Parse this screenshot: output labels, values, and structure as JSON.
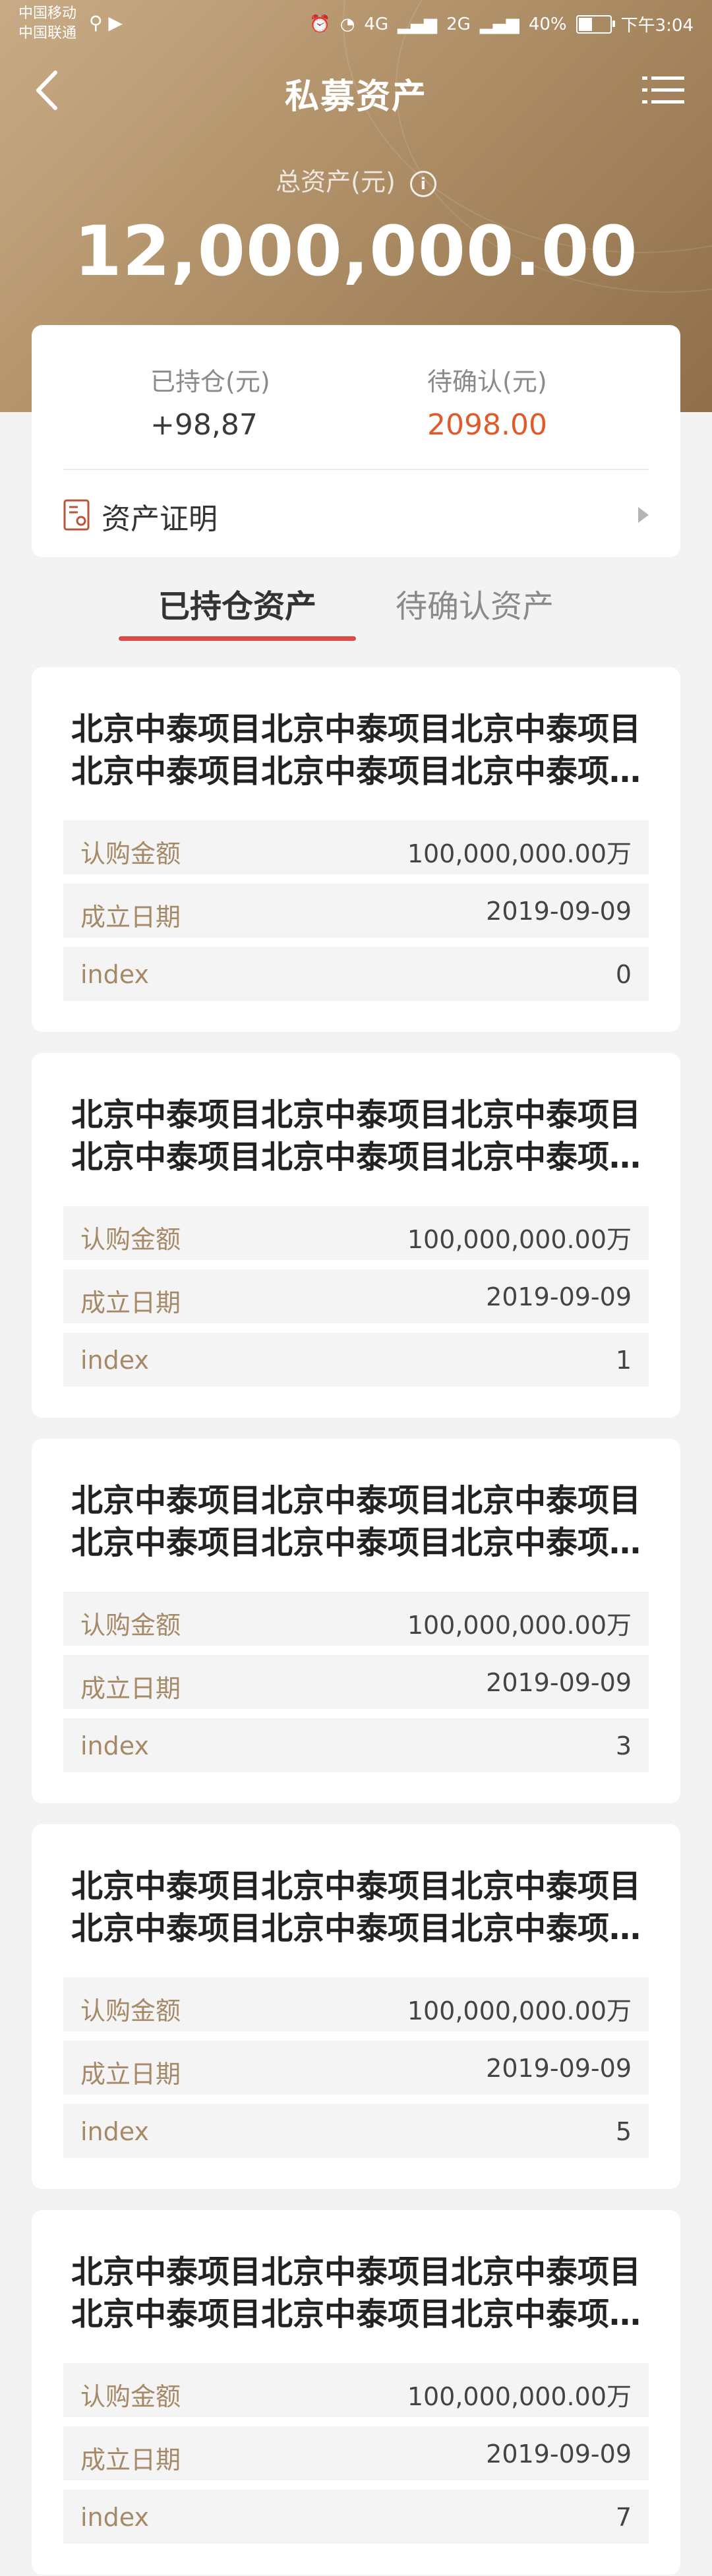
{
  "status_bar": {
    "carrier_1": "中国移动",
    "carrier_2": "中国联通",
    "network": "4G",
    "network2": "2G",
    "battery": "40%",
    "time": "下午3:04"
  },
  "nav": {
    "title": "私募资产",
    "back_icon": "chevron-left-icon",
    "menu_icon": "list-menu-icon"
  },
  "summary": {
    "total_label": "总资产(元)",
    "info_icon": "i",
    "total_value": "12,000,000.00",
    "held_label": "已持仓(元)",
    "held_value": "+98,87",
    "pending_label": "待确认(元)",
    "pending_value": "2098.00",
    "cert_label": "资产证明"
  },
  "tabs": [
    {
      "label": "已持仓资产",
      "active": true
    },
    {
      "label": "待确认资产",
      "active": false
    }
  ],
  "cards": [
    {
      "title_l1": "北京中泰项目北京中泰项目北京中泰项目",
      "title_l2": "北京中泰项目北京中泰项目北京中泰项…",
      "rows": [
        {
          "key": "认购金额",
          "value": "100,000,000.00万"
        },
        {
          "key": "成立日期",
          "value": "2019-09-09"
        },
        {
          "key": "index",
          "value": "0"
        }
      ]
    },
    {
      "title_l1": "北京中泰项目北京中泰项目北京中泰项目",
      "title_l2": "北京中泰项目北京中泰项目北京中泰项…",
      "rows": [
        {
          "key": "认购金额",
          "value": "100,000,000.00万"
        },
        {
          "key": "成立日期",
          "value": "2019-09-09"
        },
        {
          "key": "index",
          "value": "1"
        }
      ]
    },
    {
      "title_l1": "北京中泰项目北京中泰项目北京中泰项目",
      "title_l2": "北京中泰项目北京中泰项目北京中泰项…",
      "rows": [
        {
          "key": "认购金额",
          "value": "100,000,000.00万"
        },
        {
          "key": "成立日期",
          "value": "2019-09-09"
        },
        {
          "key": "index",
          "value": "3"
        }
      ]
    },
    {
      "title_l1": "北京中泰项目北京中泰项目北京中泰项目",
      "title_l2": "北京中泰项目北京中泰项目北京中泰项…",
      "rows": [
        {
          "key": "认购金额",
          "value": "100,000,000.00万"
        },
        {
          "key": "成立日期",
          "value": "2019-09-09"
        },
        {
          "key": "index",
          "value": "5"
        }
      ]
    },
    {
      "title_l1": "北京中泰项目北京中泰项目北京中泰项目",
      "title_l2": "北京中泰项目北京中泰项目北京中泰项…",
      "rows": [
        {
          "key": "认购金额",
          "value": "100,000,000.00万"
        },
        {
          "key": "成立日期",
          "value": "2019-09-09"
        },
        {
          "key": "index",
          "value": "7"
        }
      ]
    }
  ],
  "colors": {
    "gold_start": "#c8ab86",
    "gold_end": "#8f6f4a",
    "accent_red": "#e04a45",
    "pending_orange": "#e05a2c",
    "row_key_gold": "#a68a68"
  }
}
